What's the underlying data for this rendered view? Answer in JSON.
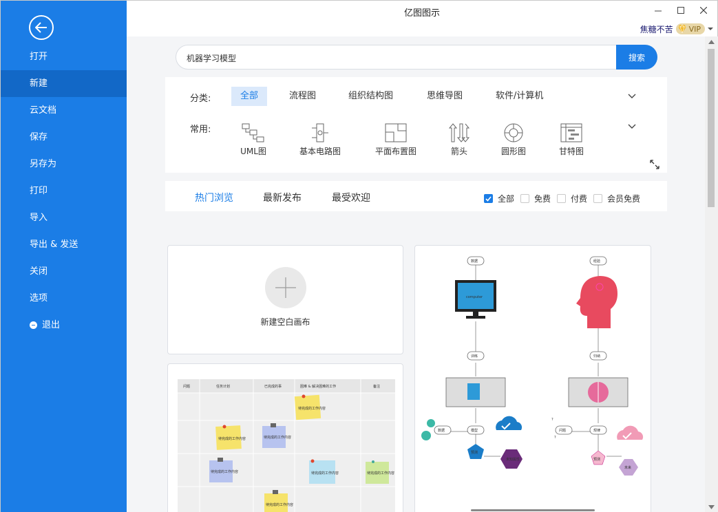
{
  "window": {
    "title": "亿图图示",
    "user_name": "焦糖不苦",
    "vip_label": "VIP"
  },
  "sidebar": {
    "items": [
      {
        "label": "打开",
        "active": false
      },
      {
        "label": "新建",
        "active": true
      },
      {
        "label": "云文档",
        "active": false
      },
      {
        "label": "保存",
        "active": false
      },
      {
        "label": "另存为",
        "active": false
      },
      {
        "label": "打印",
        "active": false
      },
      {
        "label": "导入",
        "active": false
      },
      {
        "label": "导出 & 发送",
        "active": false
      },
      {
        "label": "关闭",
        "active": false
      },
      {
        "label": "选项",
        "active": false
      },
      {
        "label": "退出",
        "active": false
      }
    ]
  },
  "search": {
    "value": "机器学习模型",
    "button_label": "搜索"
  },
  "categories": {
    "label": "分类:",
    "items": [
      "全部",
      "流程图",
      "组织结构图",
      "思维导图",
      "软件/计算机"
    ],
    "active_index": 0
  },
  "common": {
    "label": "常用:",
    "items": [
      "UML图",
      "基本电路图",
      "平面布置图",
      "箭头",
      "圆形图",
      "甘特图"
    ]
  },
  "tabs": {
    "items": [
      "热门浏览",
      "最新发布",
      "最受欢迎"
    ],
    "active_index": 0
  },
  "filters": {
    "items": [
      {
        "label": "全部",
        "checked": true
      },
      {
        "label": "免费",
        "checked": false
      },
      {
        "label": "付费",
        "checked": false
      },
      {
        "label": "会员免费",
        "checked": false
      }
    ]
  },
  "new_blank": {
    "label": "新建空白画布"
  },
  "template_kanban": {
    "headers": [
      "问题",
      "任务计划",
      "已完成的事",
      "困难 & 解决困难的工作",
      "备注"
    ],
    "note_text": "待完成的工作内容"
  },
  "template_ml": {
    "left": {
      "top_label": "数据",
      "screen_text": "computer",
      "mid_label": "训练",
      "data_label": "数据",
      "model_label": "模型",
      "predict_label": "预测",
      "unknown_label": "未知属性"
    },
    "right": {
      "top_label": "经验",
      "mid_label": "归纳",
      "question_label": "问题",
      "rule_label": "规律",
      "predict_label": "预测",
      "future_label": "未来"
    }
  },
  "colors": {
    "accent": "#1b7de6",
    "sidebar_bg": "#1b7de6",
    "sidebar_active": "#1268c7"
  }
}
